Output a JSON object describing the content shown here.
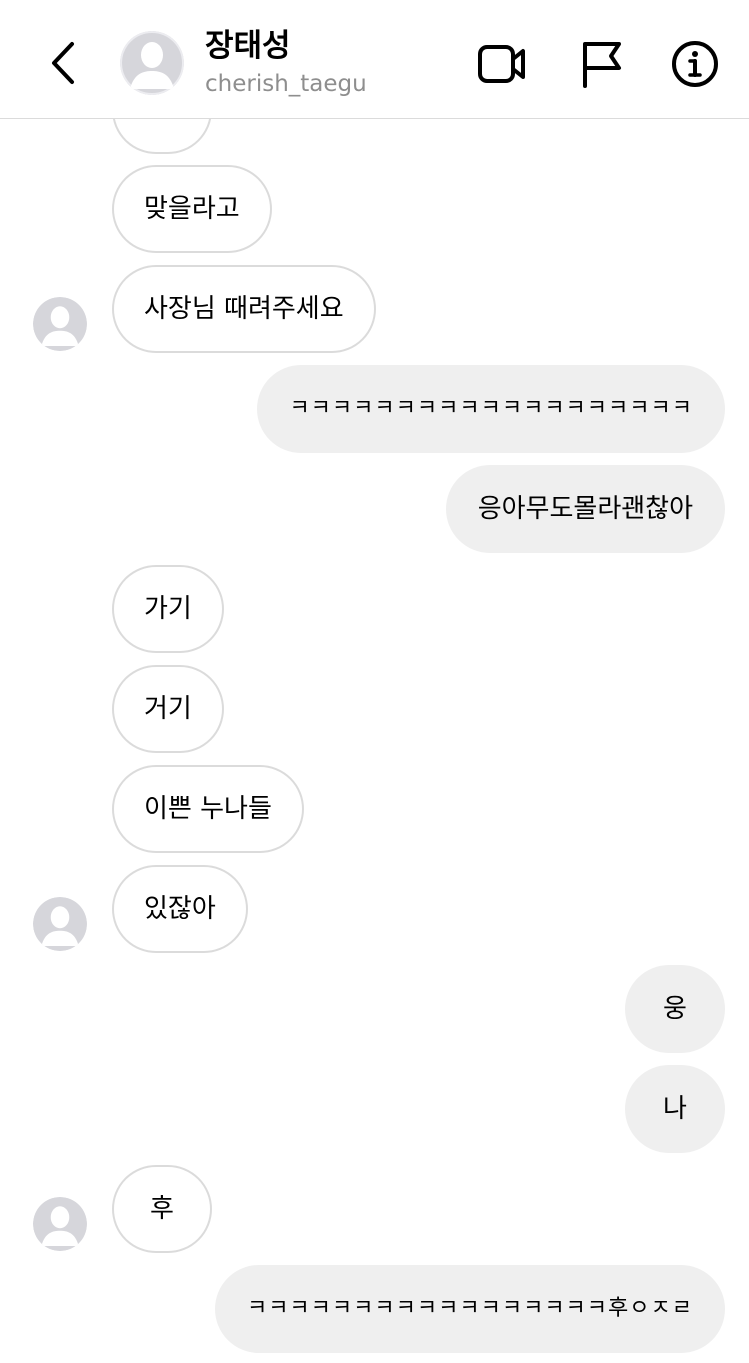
{
  "header": {
    "name": "장태성",
    "handle": "cherish_taegu",
    "icons": {
      "back": "chevron-left-icon",
      "avatar": "default-avatar-icon",
      "video": "video-call-icon",
      "flag": "flag-icon",
      "info": "info-icon"
    }
  },
  "messages": [
    {
      "side": "in",
      "text": "맞을라고"
    },
    {
      "side": "in",
      "text": "사장님 때려주세요"
    },
    {
      "side": "out",
      "text": "ㅋㅋㅋㅋㅋㅋㅋㅋㅋㅋㅋㅋㅋㅋㅋㅋㅋㅋㅋ"
    },
    {
      "side": "out",
      "text": "응아무도몰라괜찮아"
    },
    {
      "side": "in",
      "text": "가기"
    },
    {
      "side": "in",
      "text": "거기"
    },
    {
      "side": "in",
      "text": "이쁜 누나들"
    },
    {
      "side": "in",
      "text": "있잖아"
    },
    {
      "side": "out",
      "text": "웅"
    },
    {
      "side": "out",
      "text": "나"
    },
    {
      "side": "in",
      "text": "후"
    },
    {
      "side": "out",
      "text": "ㅋㅋㅋㅋㅋㅋㅋㅋㅋㅋㅋㅋㅋㅋㅋㅋㅋ후ㅇㅈㄹ"
    }
  ],
  "colors": {
    "incoming_bubble": "#ffffff",
    "incoming_border": "#dbdbdb",
    "outgoing_bubble": "#efefef",
    "handle_text": "#8e8e8e",
    "avatar_bg": "#d6d6db"
  }
}
